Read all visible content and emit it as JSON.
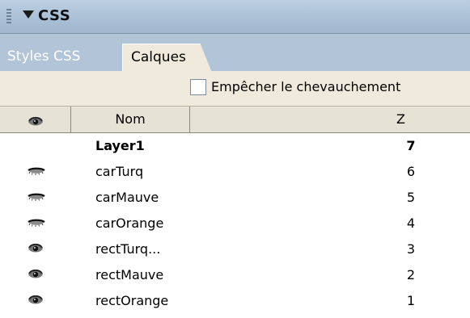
{
  "panel": {
    "title": "CSS"
  },
  "tabs": [
    {
      "label": "Styles CSS",
      "active": false
    },
    {
      "label": "Calques",
      "active": true
    }
  ],
  "options": {
    "prevent_overlap_label": "Empêcher le chevauchement",
    "prevent_overlap_checked": false
  },
  "columns": {
    "visibility_icon": "eye-icon",
    "name": "Nom",
    "z": "Z"
  },
  "layers": [
    {
      "name": "Layer1",
      "z": "7",
      "visibility": "none",
      "selected": true
    },
    {
      "name": "carTurq",
      "z": "6",
      "visibility": "hidden"
    },
    {
      "name": "carMauve",
      "z": "5",
      "visibility": "hidden"
    },
    {
      "name": "carOrange",
      "z": "4",
      "visibility": "hidden"
    },
    {
      "name": "rectTurq...",
      "z": "3",
      "visibility": "visible"
    },
    {
      "name": "rectMauve",
      "z": "2",
      "visibility": "visible"
    },
    {
      "name": "rectOrange",
      "z": "1",
      "visibility": "visible"
    }
  ],
  "colors": {
    "header": "#a9bfd5",
    "tabs_bg": "#b2c4d8",
    "options_bg": "#efeadb"
  }
}
